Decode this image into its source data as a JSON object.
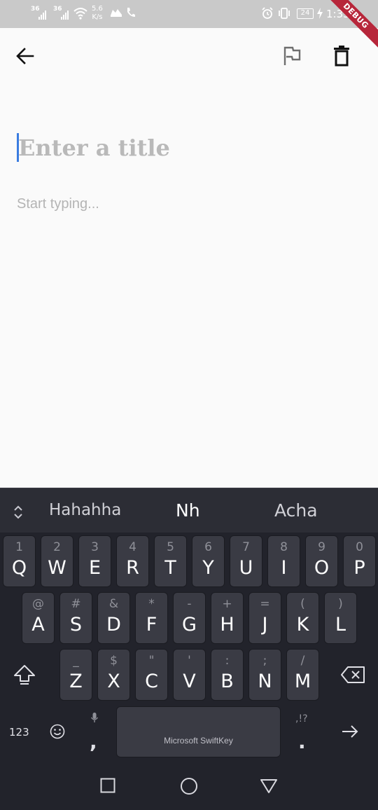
{
  "status_bar": {
    "signal1_label": "36",
    "signal2_label": "36",
    "net_speed_value": "5.6",
    "net_speed_unit": "K/s",
    "battery": "24",
    "time": "1:35",
    "debug_banner": "DEBUG"
  },
  "toolbar": {
    "back_icon": "arrow-left-icon",
    "flag_icon": "flag-icon",
    "delete_icon": "trash-icon"
  },
  "editor": {
    "title_placeholder": "Enter a title",
    "title_value": "",
    "body_placeholder": "Start typing...",
    "body_value": ""
  },
  "keyboard": {
    "suggestions": [
      "Hahahha",
      "Nh",
      "Acha"
    ],
    "row1": [
      {
        "main": "Q",
        "hint": "1"
      },
      {
        "main": "W",
        "hint": "2"
      },
      {
        "main": "E",
        "hint": "3"
      },
      {
        "main": "R",
        "hint": "4"
      },
      {
        "main": "T",
        "hint": "5"
      },
      {
        "main": "Y",
        "hint": "6"
      },
      {
        "main": "U",
        "hint": "7"
      },
      {
        "main": "I",
        "hint": "8"
      },
      {
        "main": "O",
        "hint": "9"
      },
      {
        "main": "P",
        "hint": "0"
      }
    ],
    "row2": [
      {
        "main": "A",
        "hint": "@"
      },
      {
        "main": "S",
        "hint": "#"
      },
      {
        "main": "D",
        "hint": "&"
      },
      {
        "main": "F",
        "hint": "*"
      },
      {
        "main": "G",
        "hint": "-"
      },
      {
        "main": "H",
        "hint": "+"
      },
      {
        "main": "J",
        "hint": "="
      },
      {
        "main": "K",
        "hint": "("
      },
      {
        "main": "L",
        "hint": ")"
      }
    ],
    "row3": [
      {
        "main": "Z",
        "hint": "_"
      },
      {
        "main": "X",
        "hint": "$"
      },
      {
        "main": "C",
        "hint": "\""
      },
      {
        "main": "V",
        "hint": "'"
      },
      {
        "main": "B",
        "hint": ":"
      },
      {
        "main": "N",
        "hint": ";"
      },
      {
        "main": "M",
        "hint": "/"
      }
    ],
    "numbers_key": "123",
    "comma_key": ",",
    "period_key": ".",
    "period_hint": ",!?",
    "space_label": "Microsoft SwiftKey"
  }
}
